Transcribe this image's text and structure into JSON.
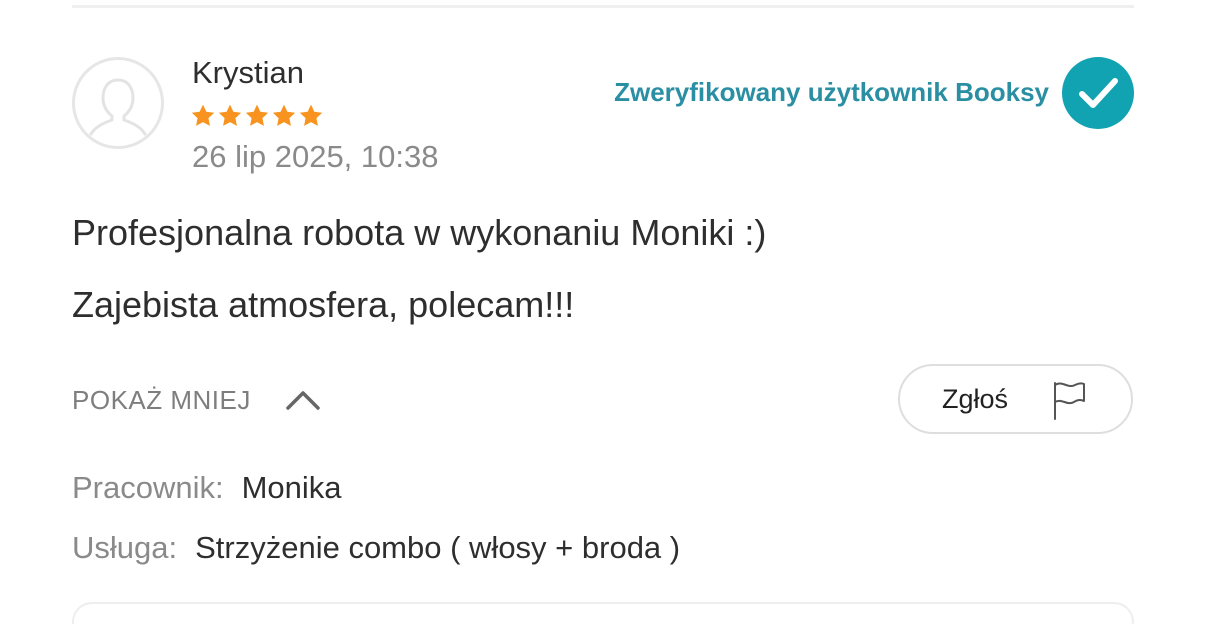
{
  "review": {
    "author": "Krystian",
    "rating": 5,
    "date": "26 lip 2025, 10:38",
    "verified_label": "Zweryfikowany użytkownik Booksy",
    "body_lines": [
      "Profesjonalna robota w wykonaniu Moniki :)",
      "Zajebista atmosfera, polecam!!!"
    ],
    "show_less_label": "POKAŻ MNIEJ",
    "report_label": "Zgłoś",
    "employee_label": "Pracownik:",
    "employee_value": "Monika",
    "service_label": "Usługa:",
    "service_value": "Strzyżenie combo ( włosy + broda )"
  },
  "icons": {
    "avatar": "user-silhouette-icon",
    "star": "star-icon",
    "verified": "checkmark-circle-icon",
    "chevron": "chevron-up-icon",
    "flag": "flag-icon"
  },
  "colors": {
    "star": "#f7931e",
    "verified_text": "#2a8fa3",
    "verified_badge": "#12a3b3",
    "primary_text": "#2e2e2e",
    "secondary_text": "#8a8a8a"
  }
}
